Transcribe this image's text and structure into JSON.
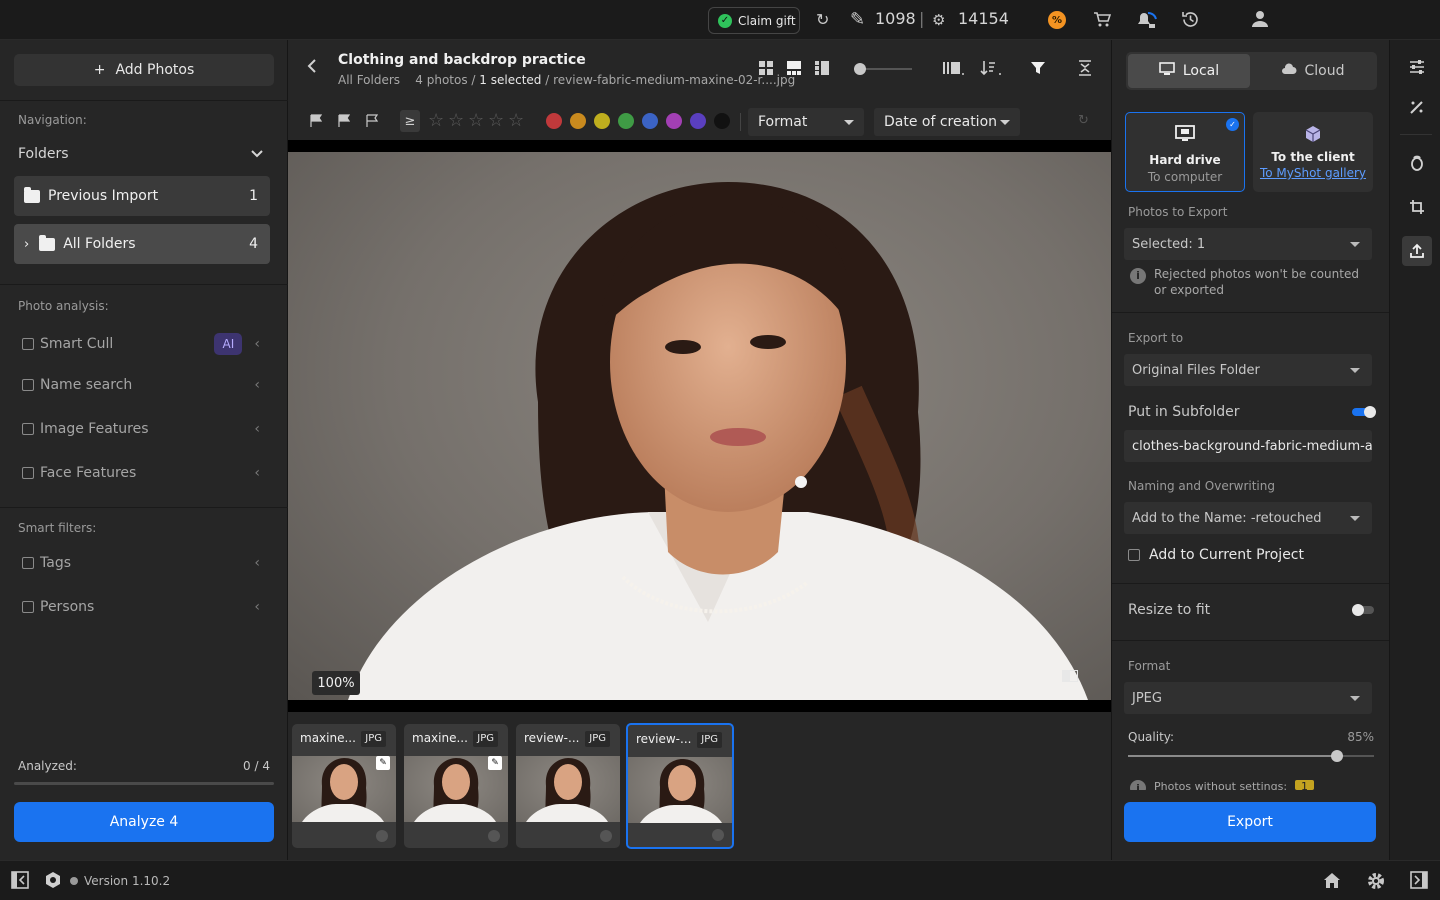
{
  "topbar": {
    "claim_gift": "Claim gift",
    "credits_count": "1098",
    "ai_count": "14154",
    "separator": "|",
    "icons": [
      "refresh-icon",
      "magic-wand-icon",
      "ai-coin-icon",
      "discount-icon",
      "cart-icon",
      "notifications-icon",
      "history-icon",
      "user-icon"
    ]
  },
  "left": {
    "add_photos": "Add Photos",
    "add_icon": "+",
    "navigation_label": "Navigation:",
    "folders_label": "Folders",
    "folders": [
      {
        "name": "Previous Import",
        "count": "1"
      },
      {
        "name": "All Folders",
        "count": "4"
      }
    ],
    "photo_analysis_label": "Photo analysis:",
    "analysis_items": [
      {
        "label": "Smart Cull",
        "badge": "AI"
      },
      {
        "label": "Name search"
      },
      {
        "label": "Image Features"
      },
      {
        "label": "Face Features"
      }
    ],
    "smart_filters_label": "Smart filters:",
    "smart_filters": [
      {
        "label": "Tags"
      },
      {
        "label": "Persons"
      }
    ],
    "analyzed_label": "Analyzed:",
    "analyzed_value": "0 / 4",
    "analyzed_fraction": 0,
    "analyze_button": "Analyze 4"
  },
  "center": {
    "title": "Clothing and backdrop practice",
    "crumb_root": "All Folders",
    "photo_count": "4 photos /",
    "selected": "1 selected",
    "filename": "/ review-fabric-medium-maxine-02-r....jpg",
    "ge_symbol": "≥",
    "star_rating": 0,
    "stars": [
      "☆",
      "☆",
      "☆",
      "☆",
      "☆"
    ],
    "color_labels": [
      "#c0393b",
      "#c98a1e",
      "#bfae1e",
      "#3f9b45",
      "#3b63c4",
      "#a23fb4",
      "#5a3fbf",
      "#111111"
    ],
    "format_dropdown": "Format",
    "sort_dropdown": "Date of creation",
    "zoom": "100%",
    "thumbnails": [
      {
        "name": "maxine...",
        "type": "JPG",
        "edited": true,
        "selected": false
      },
      {
        "name": "maxine...",
        "type": "JPG",
        "edited": true,
        "selected": false
      },
      {
        "name": "review-...",
        "type": "JPG",
        "edited": false,
        "selected": false
      },
      {
        "name": "review-...",
        "type": "JPG",
        "edited": false,
        "selected": true
      }
    ]
  },
  "right": {
    "local_tab": "Local",
    "cloud_tab": "Cloud",
    "dest_hard_drive_title": "Hard drive",
    "dest_hard_drive_sub": "To computer",
    "dest_client_title": "To the client",
    "dest_client_link": "To MyShot gallery",
    "photos_to_export_label": "Photos to Export",
    "photos_to_export_value": "Selected: 1",
    "rejected_note": "Rejected photos won't be counted or exported",
    "export_to_label": "Export to",
    "export_to_value": "Original Files Folder",
    "subfolder_label": "Put in Subfolder",
    "subfolder_on": true,
    "subfolder_value": "clothes-background-fabric-medium-abf",
    "naming_label": "Naming and Overwriting",
    "naming_value": "Add to the Name: -retouched",
    "add_to_project": "Add to Current Project",
    "resize_label": "Resize to fit",
    "resize_on": false,
    "format_label": "Format",
    "format_value": "JPEG",
    "quality_label": "Quality:",
    "quality_value": "85%",
    "quality_fraction": 0.85,
    "partial_note": "Photos without settings:",
    "partial_count": "1",
    "export_button": "Export"
  },
  "rtools": [
    "sliders-icon",
    "retouch-icon",
    "mask-icon",
    "crop-icon",
    "export-icon"
  ],
  "bottom": {
    "version": "Version 1.10.2"
  }
}
